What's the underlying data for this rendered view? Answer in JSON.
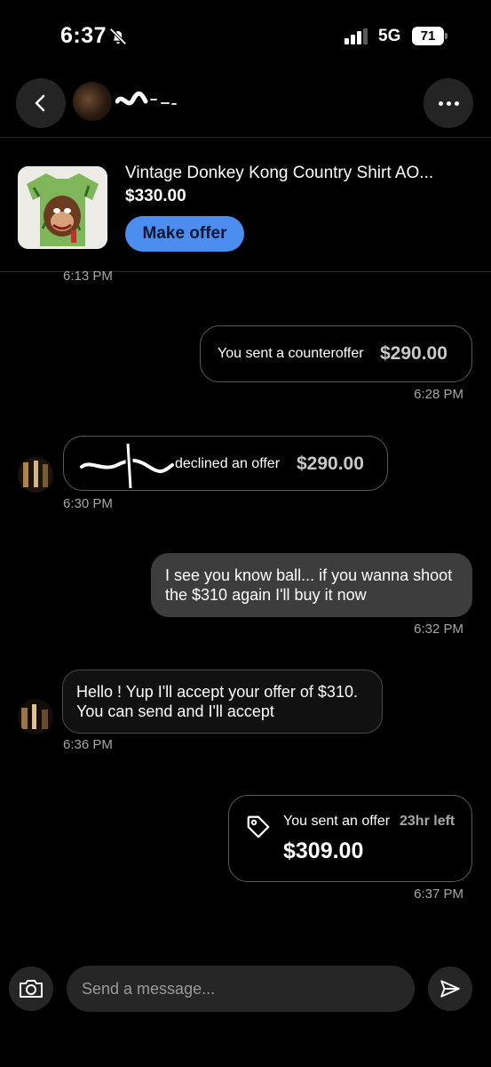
{
  "status_bar": {
    "time": "6:37",
    "network": "5G",
    "battery": "71"
  },
  "listing": {
    "title": "Vintage Donkey Kong Country Shirt AO...",
    "price": "$330.00",
    "offer_button": "Make offer"
  },
  "messages": [
    {
      "timestamp": "6:13 PM"
    },
    {
      "type": "counteroffer",
      "label": "You sent a counteroffer",
      "amount": "$290.00",
      "timestamp": "6:28 PM"
    },
    {
      "type": "declined",
      "label": "declined an offer",
      "amount": "$290.00",
      "timestamp": "6:30 PM"
    },
    {
      "type": "text",
      "text": "I see you know ball... if you wanna shoot the $310 again I'll buy it now",
      "timestamp": "6:32 PM"
    },
    {
      "type": "text",
      "text": "Hello ! Yup I'll accept your offer of $310. You can send and I'll accept",
      "timestamp": "6:36 PM"
    },
    {
      "type": "offer",
      "label": "You sent an offer",
      "time_left": "23hr left",
      "amount": "$309.00",
      "timestamp": "6:37 PM"
    }
  ],
  "composer": {
    "placeholder": "Send a message..."
  },
  "colors": {
    "accent": "#4b8ef0",
    "background": "#000000",
    "bubble": "#3d3d3d"
  }
}
